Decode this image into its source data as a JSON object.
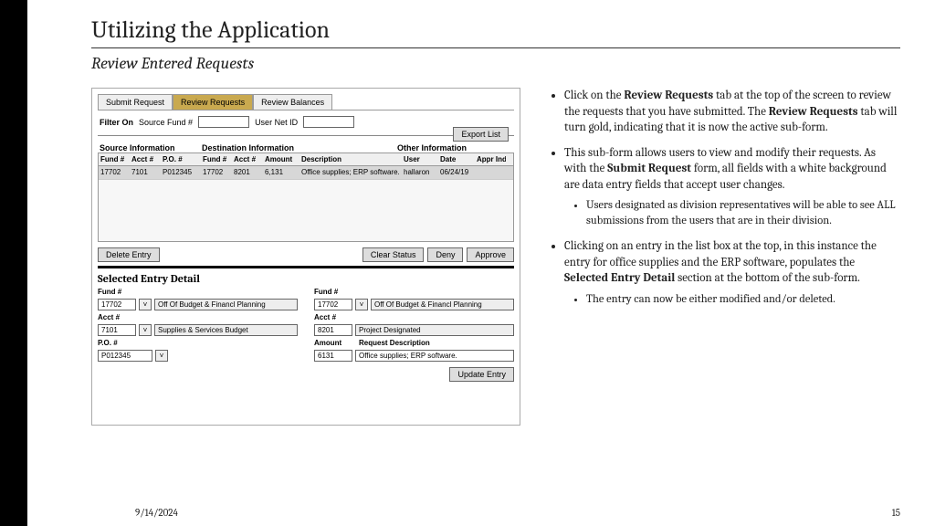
{
  "header": {
    "title": "Utilizing the Application",
    "subtitle": "Review Entered Requests"
  },
  "footer": {
    "date": "9/14/2024",
    "page": "15"
  },
  "app": {
    "tabs": {
      "submit": "Submit Request",
      "review": "Review Requests",
      "balances": "Review Balances"
    },
    "filter": {
      "label": "Filter On",
      "f1": "Source Fund #",
      "f2": "User Net ID"
    },
    "buttons": {
      "export": "Export List",
      "delete": "Delete Entry",
      "clear": "Clear Status",
      "deny": "Deny",
      "approve": "Approve",
      "update": "Update Entry"
    },
    "groups": {
      "src": "Source Information",
      "dest": "Destination Information",
      "other": "Other Information"
    },
    "cols": {
      "fund": "Fund #",
      "acct": "Acct #",
      "po": "P.O. #",
      "fund2": "Fund #",
      "acct2": "Acct #",
      "amt": "Amount",
      "desc": "Description",
      "user": "User",
      "date": "Date",
      "appr": "Appr Ind"
    },
    "row": {
      "fund": "17702",
      "acct": "7101",
      "po": "P012345",
      "fund2": "17702",
      "acct2": "8201",
      "amt": "6,131",
      "desc": "Office supplies; ERP software.",
      "user": "hallaron",
      "date": "06/24/19",
      "appr": ""
    },
    "detail": {
      "title": "Selected Entry Detail",
      "labels": {
        "fund": "Fund #",
        "acct": "Acct #",
        "po": "P.O. #",
        "amount": "Amount",
        "reqdesc": "Request Description"
      },
      "left": {
        "fund": "17702",
        "funddesc": "Off Of Budget & Financl Planning",
        "acct": "7101",
        "acctdesc": "Supplies & Services Budget",
        "po": "P012345"
      },
      "right": {
        "fund": "17702",
        "funddesc": "Off Of Budget & Financl Planning",
        "acct": "8201",
        "acctdesc": "Project Designated",
        "amount": "6131",
        "reqdesc": "Office supplies; ERP software."
      },
      "dd": "˅"
    }
  },
  "notes": {
    "b1a": "Click on the ",
    "b1b": "Review Requests",
    "b1c": " tab at the top of the screen to review the requests that you have submitted. The ",
    "b1d": "Review Requests",
    "b1e": " tab will turn gold, indicating that it is now the active sub-form.",
    "b2a": "This sub-form allows users to view and modify their requests. As with the ",
    "b2b": "Submit Request",
    "b2c": " form, all fields with a white background are data entry fields that accept user changes.",
    "b2s1": "Users designated as division representatives will be able to see ALL submissions from the users that are in their division.",
    "b3a": "Clicking on an entry in the list box at the top, in this instance the entry for office supplies and the ERP software, populates the ",
    "b3b": "Selected Entry Detail",
    "b3c": " section at the bottom of the sub-form.",
    "b3s1": "The entry can now be either modified and/or deleted."
  }
}
